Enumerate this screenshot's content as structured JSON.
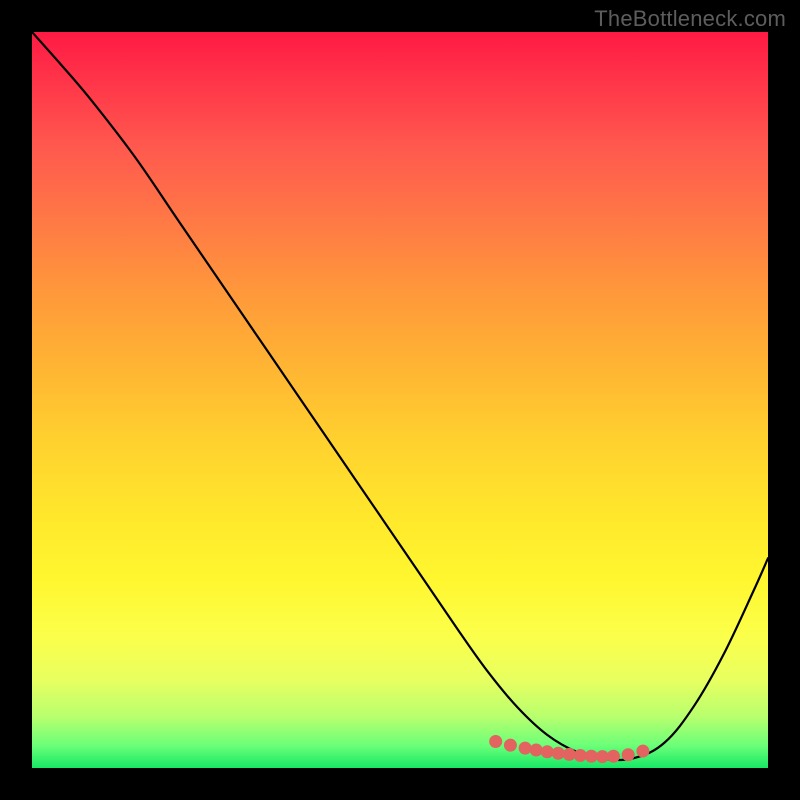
{
  "watermark": "TheBottleneck.com",
  "colors": {
    "frame": "#000000",
    "gradient_top": "#ff1a44",
    "gradient_bottom": "#17e765",
    "curve": "#000000",
    "marker_fill": "#e2635f",
    "marker_stroke": "#a33b39"
  },
  "chart_data": {
    "type": "line",
    "title": "",
    "xlabel": "",
    "ylabel": "",
    "xlim": [
      0,
      100
    ],
    "ylim": [
      0,
      100
    ],
    "series": [
      {
        "name": "bottleneck-curve",
        "x": [
          0,
          4,
          8,
          14,
          20,
          28,
          36,
          44,
          52,
          58,
          62,
          66,
          70,
          74,
          78,
          82,
          86,
          90,
          94,
          98,
          100
        ],
        "y": [
          100,
          95.5,
          90.8,
          83,
          74.2,
          62.5,
          50.8,
          39.1,
          27.4,
          18.6,
          13,
          8.2,
          4.5,
          2.2,
          1.2,
          1.4,
          3.5,
          8.5,
          15.5,
          24,
          28.5
        ]
      }
    ],
    "markers": {
      "name": "optimal-range",
      "x": [
        63,
        65,
        67,
        68.5,
        70,
        71.5,
        73,
        74.5,
        76,
        77.5,
        79,
        81,
        83
      ],
      "y": [
        3.6,
        3.1,
        2.7,
        2.45,
        2.2,
        2.0,
        1.85,
        1.7,
        1.6,
        1.55,
        1.6,
        1.8,
        2.3
      ]
    }
  }
}
